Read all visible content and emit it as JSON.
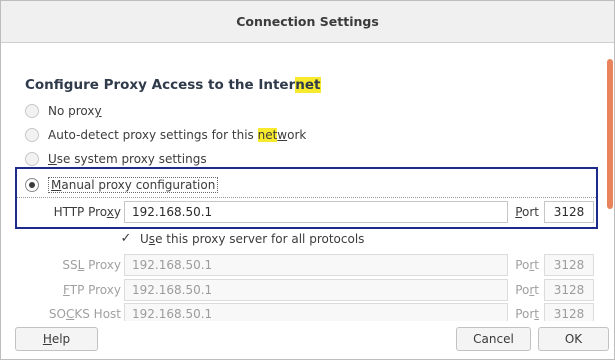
{
  "window": {
    "title": "Connection Settings"
  },
  "section": {
    "title_part1": "Configure Proxy Access to the Inter",
    "title_highlight": "net"
  },
  "radios": {
    "no_proxy": {
      "label_pre": "No prox",
      "label_ul": "y",
      "label_post": ""
    },
    "auto_detect": {
      "label_pre": "Auto-detect proxy settings for this ",
      "label_hl": "net",
      "label_ul": "w",
      "label_post": "ork"
    },
    "system": {
      "label_ul": "U",
      "label_post": "se system proxy settings"
    },
    "manual": {
      "label_ul": "M",
      "label_post": "anual proxy configuration"
    }
  },
  "http": {
    "label_pre": "HTTP Pro",
    "label_ul": "x",
    "label_post": "y",
    "value": "192.168.50.1",
    "port_label_ul": "P",
    "port_label_post": "ort",
    "port": "3128"
  },
  "use_for_all": {
    "label_pre": "U",
    "label_ul": "s",
    "label_post": "e this proxy server for all protocols",
    "checked": true
  },
  "ssl": {
    "label_pre": "SS",
    "label_ul": "L",
    "label_post": " Proxy",
    "value": "192.168.50.1",
    "port_label_pre": "Po",
    "port_label_ul": "r",
    "port_label_post": "t",
    "port": "3128"
  },
  "ftp": {
    "label_ul": "F",
    "label_post": "TP Proxy",
    "value": "192.168.50.1",
    "port_label_pre": "Po",
    "port_label_ul": "r",
    "port_label_post": "t",
    "port": "3128"
  },
  "socks": {
    "label_pre": "SO",
    "label_ul": "C",
    "label_post": "KS Host",
    "value": "192.168.50.1",
    "port_label_pre": "Por",
    "port_label_ul": "t",
    "port_label_post": "",
    "port": "3128"
  },
  "buttons": {
    "help_ul": "H",
    "help_post": "elp",
    "cancel": "Cancel",
    "ok": "OK"
  },
  "colors": {
    "highlight": "#f7e92b",
    "focus_box": "#1d2a8a",
    "scroll_thumb": "#e9835b"
  }
}
